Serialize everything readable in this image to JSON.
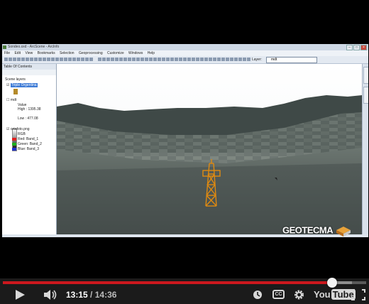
{
  "window": {
    "title": "Sondeo.sxd - ArcScene - ArcInfo"
  },
  "menubar": {
    "items": [
      "File",
      "Edit",
      "View",
      "Bookmarks",
      "Selection",
      "Geoprocessing",
      "Customize",
      "Windows",
      "Help"
    ]
  },
  "toolbar": {
    "layer_label": "Layer:",
    "layer_value": "mdt"
  },
  "toc": {
    "title": "Table Of Contents",
    "scene_layers": "Scene layers",
    "layer1": "Triple Orgentina",
    "layer2": "mdt",
    "value_label": "Value",
    "high_label": "High : 1395.38",
    "low_label": "Low : 477.08",
    "layer3": "ortofoto.png",
    "rgb_label": "RGB",
    "red": "Red:",
    "red_band": "Band_1",
    "green": "Green:",
    "green_band": "Band_2",
    "blue": "Blue:",
    "blue_band": "Band_3"
  },
  "watermark": "GEOTECMA",
  "player": {
    "current_time": "13:15",
    "separator": "/",
    "duration": "14:36",
    "played_fraction": 0.907,
    "buffered_fraction": 0.96,
    "cc_label": "CC",
    "logo_you": "You",
    "logo_tube": "Tube"
  },
  "colors": {
    "progress": "#cc181e",
    "controls_bg": "#1b1b1b",
    "selection": "#3d7bd6"
  }
}
